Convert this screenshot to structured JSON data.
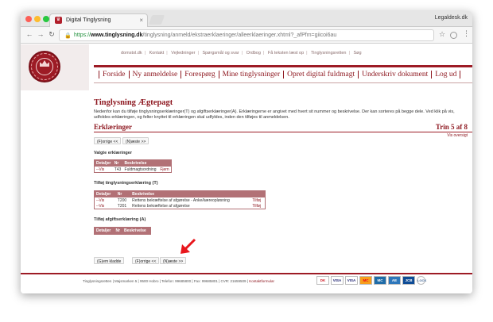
{
  "browser": {
    "tab_title": "Digital Tinglysning",
    "tab_favicon": "crown-favicon-icon",
    "tab_close": "×",
    "profile_label": "Legaldesk.dk",
    "url_scheme": "https://",
    "url_host": "www.tinglysning.dk",
    "url_path": "/tinglysning/anmeld/ekstraerklaeringer/alleerklaeringer.xhtml?_afPfm=giicoi6au"
  },
  "toplinks": [
    "domstol.dk",
    "Kontakt",
    "Vejledninger",
    "Spørgsmål og svar",
    "Ordbog",
    "Få teksten læst op",
    "Tinglysningsretten",
    "Søg"
  ],
  "mainnav": [
    "Forside",
    "Ny anmeldelse",
    "Forespørg",
    "Mine tinglysninger",
    "Opret digital fuldmagt",
    "Underskriv dokument",
    "Log ud"
  ],
  "page": {
    "heading": "Tinglysning Ægtepagt",
    "intro": "Nedenfor kan du tilføje tinglysningserklæringer(T) og afgiftserklæringer(A). Erklæringerne er angivet med hvert sit nummer og beskrivelse. Der kan sorteres på begge dele. Ved klik på vis, udfoldes erklæringen, og felter knyttet til erklæringen skal udfyldes, inden den tilføjes til anmeldelsen.",
    "subheading": "Erklæringer",
    "step": "Trin 5 af 8",
    "view_all": "Vis oversigt",
    "prev_button": "(F)orrige <<",
    "next_button": "(N)æste >>",
    "save_draft_button": "(G)em kladde"
  },
  "chosen": {
    "title": "Valgte erklæringer",
    "headers": [
      "Detaljer",
      "Nr",
      "Beskrivelse",
      ""
    ],
    "rows": [
      {
        "detail": "--Vis",
        "nr": "T43",
        "desc": "Fuldmagtsordning",
        "action": "Fjern"
      }
    ]
  },
  "tinglysning": {
    "title": "Tilføj tinglysningserklæring (T)",
    "headers": [
      "Detaljer",
      "Nr",
      "Beskrivelse",
      ""
    ],
    "rows": [
      {
        "detail": "--Vis",
        "nr": "T200",
        "desc": "Rettens bekræftelse af afgørelse - Anke/kæreopløsning",
        "action": "Tilføj"
      },
      {
        "detail": "--Vis",
        "nr": "T201",
        "desc": "Rettens bekræftelse af afgørelse",
        "action": "Tilføj"
      }
    ]
  },
  "afgift": {
    "title": "Tilføj afgiftserklæring (A)",
    "headers": [
      "Detaljer",
      "Nr",
      "Beskrivelse"
    ]
  },
  "footer": {
    "items": [
      "Tinglysningsretten",
      "Majsmarken 5",
      "9500 Hobro",
      "Telefon: 99685800",
      "Fax: 99685801",
      "CVR: 21659509"
    ],
    "contact": "Kontaktformular",
    "cards": [
      "DK",
      "VISA",
      "VISA",
      "MC",
      "MC",
      "AE",
      "JCB",
      "LOCK"
    ]
  },
  "colors": {
    "brand": "#8e1820",
    "table_header": "#b27176",
    "arrow": "#e8161c"
  }
}
